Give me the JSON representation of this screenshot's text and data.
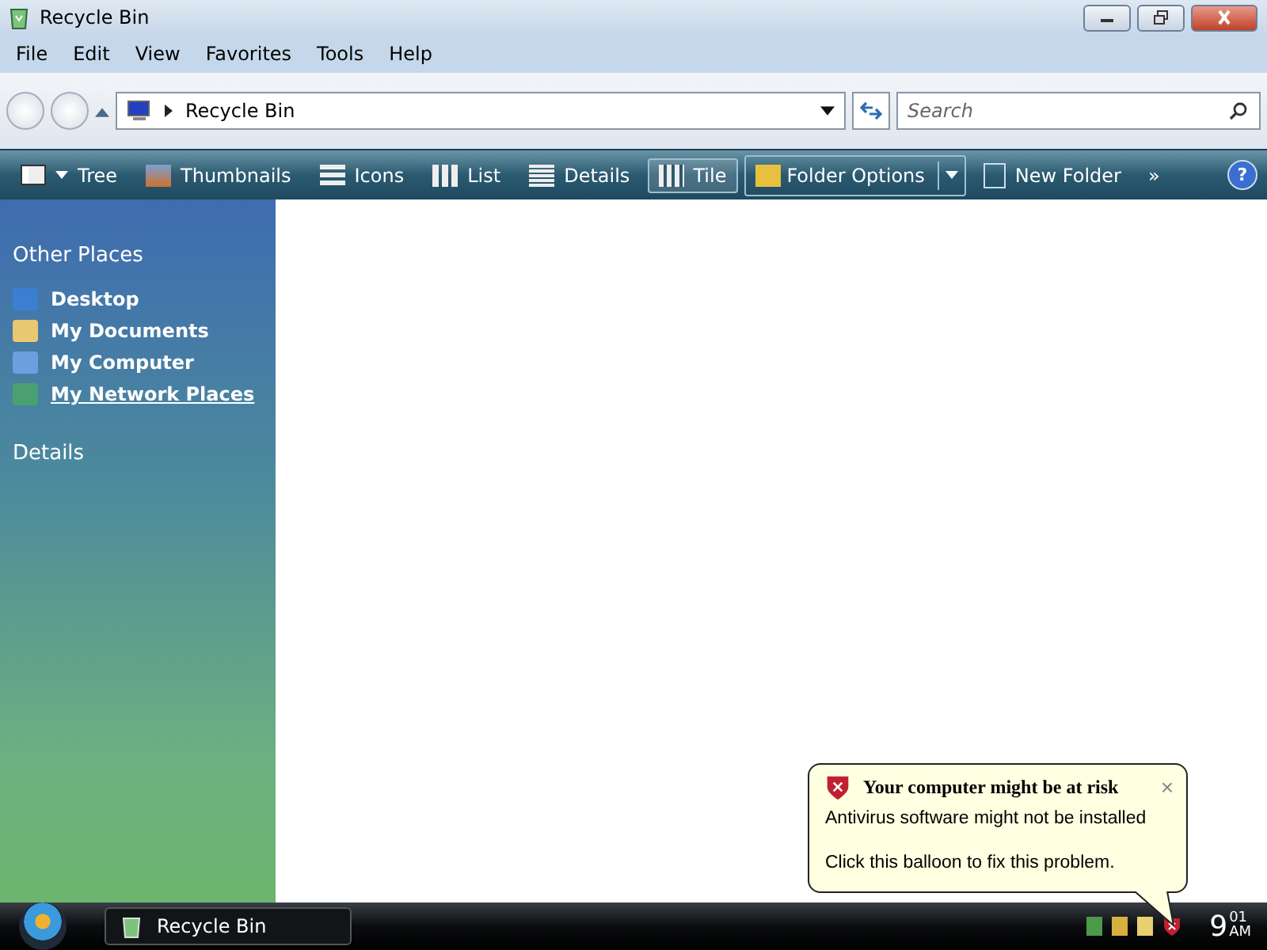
{
  "window": {
    "title": "Recycle Bin"
  },
  "menu": [
    "File",
    "Edit",
    "View",
    "Favorites",
    "Tools",
    "Help"
  ],
  "address": {
    "path": "Recycle Bin"
  },
  "search": {
    "placeholder": "Search"
  },
  "toolbar": [
    {
      "kind": "view",
      "label": "Tree",
      "selected": false
    },
    {
      "kind": "view",
      "label": "Thumbnails",
      "selected": false
    },
    {
      "kind": "view",
      "label": "Icons",
      "selected": false
    },
    {
      "kind": "view",
      "label": "List",
      "selected": false
    },
    {
      "kind": "view",
      "label": "Details",
      "selected": false
    },
    {
      "kind": "view",
      "label": "Tile",
      "selected": true
    },
    {
      "kind": "split",
      "label": "Folder Options"
    },
    {
      "kind": "view",
      "label": "New Folder",
      "selected": false
    },
    {
      "kind": "more",
      "label": "»"
    }
  ],
  "help": "?",
  "sidebar": {
    "sections": [
      {
        "title": "Other Places",
        "items": [
          {
            "label": "Desktop",
            "hovered": false
          },
          {
            "label": "My Documents",
            "hovered": false
          },
          {
            "label": "My Computer",
            "hovered": false
          },
          {
            "label": "My Network Places",
            "hovered": true
          }
        ]
      },
      {
        "title": "Details"
      }
    ]
  },
  "balloon": {
    "title": "Your computer might be at risk",
    "lines": [
      "Antivirus software might not be installed",
      "Click this balloon to fix this problem."
    ],
    "close": "×"
  },
  "taskbar": {
    "buttons": [
      {
        "label": "Recycle Bin"
      }
    ],
    "clock": {
      "hour": "9",
      "minutes": "01",
      "ampm": "AM"
    }
  }
}
